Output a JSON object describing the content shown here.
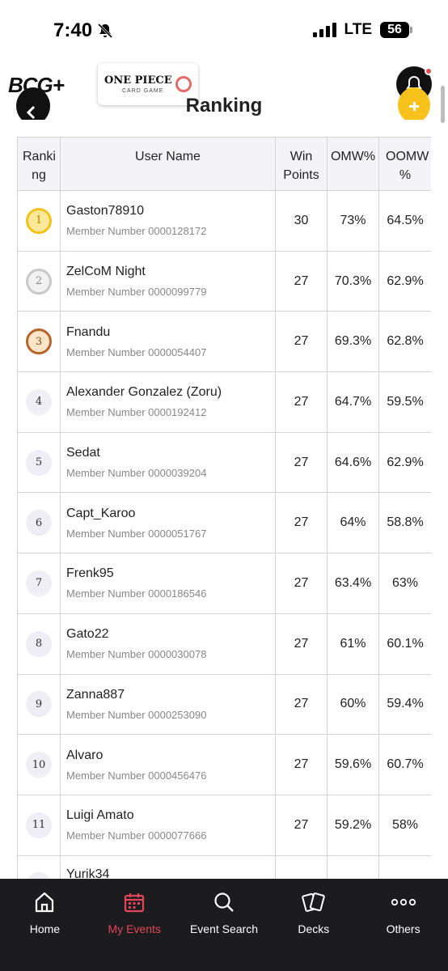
{
  "status": {
    "time": "7:40",
    "network": "LTE",
    "battery": "56"
  },
  "header": {
    "app_logo": "BCG+",
    "game_logo_title": "ONE PIECE",
    "game_logo_sub": "CARD GAME"
  },
  "page": {
    "title": "Ranking"
  },
  "table": {
    "headers": {
      "rank": "Ranki ng",
      "name": "User Name",
      "win": "Win Points",
      "omw": "OMW%",
      "oomw": "OOMW %"
    },
    "rows": [
      {
        "rank": "1",
        "name": "Gaston78910",
        "member": "Member Number 0000128172",
        "win": "30",
        "omw": "73%",
        "oomw": "64.5%"
      },
      {
        "rank": "2",
        "name": "ZelCoM Night",
        "member": "Member Number 0000099779",
        "win": "27",
        "omw": "70.3%",
        "oomw": "62.9%"
      },
      {
        "rank": "3",
        "name": "Fnandu",
        "member": "Member Number 0000054407",
        "win": "27",
        "omw": "69.3%",
        "oomw": "62.8%"
      },
      {
        "rank": "4",
        "name": "Alexander Gonzalez (Zoru)",
        "member": "Member Number 0000192412",
        "win": "27",
        "omw": "64.7%",
        "oomw": "59.5%"
      },
      {
        "rank": "5",
        "name": "Sedat",
        "member": "Member Number 0000039204",
        "win": "27",
        "omw": "64.6%",
        "oomw": "62.9%"
      },
      {
        "rank": "6",
        "name": "Capt_Karoo",
        "member": "Member Number 0000051767",
        "win": "27",
        "omw": "64%",
        "oomw": "58.8%"
      },
      {
        "rank": "7",
        "name": "Frenk95",
        "member": "Member Number 0000186546",
        "win": "27",
        "omw": "63.4%",
        "oomw": "63%"
      },
      {
        "rank": "8",
        "name": "Gato22",
        "member": "Member Number 0000030078",
        "win": "27",
        "omw": "61%",
        "oomw": "60.1%"
      },
      {
        "rank": "9",
        "name": "Zanna887",
        "member": "Member Number 0000253090",
        "win": "27",
        "omw": "60%",
        "oomw": "59.4%"
      },
      {
        "rank": "10",
        "name": "Alvaro",
        "member": "Member Number 0000456476",
        "win": "27",
        "omw": "59.6%",
        "oomw": "60.7%"
      },
      {
        "rank": "11",
        "name": "Luigi Amato",
        "member": "Member Number 0000077666",
        "win": "27",
        "omw": "59.2%",
        "oomw": "58%"
      },
      {
        "rank": "",
        "name": "Yurik34",
        "member": "",
        "win": "",
        "omw": "",
        "oomw": ""
      }
    ]
  },
  "nav": {
    "home": "Home",
    "my_events": "My Events",
    "event_search": "Event Search",
    "decks": "Decks",
    "others": "Others"
  },
  "colors": {
    "active_nav": "#e2465a",
    "nav_bg": "#1c1c1e",
    "accent_yellow": "#f7c21b"
  }
}
